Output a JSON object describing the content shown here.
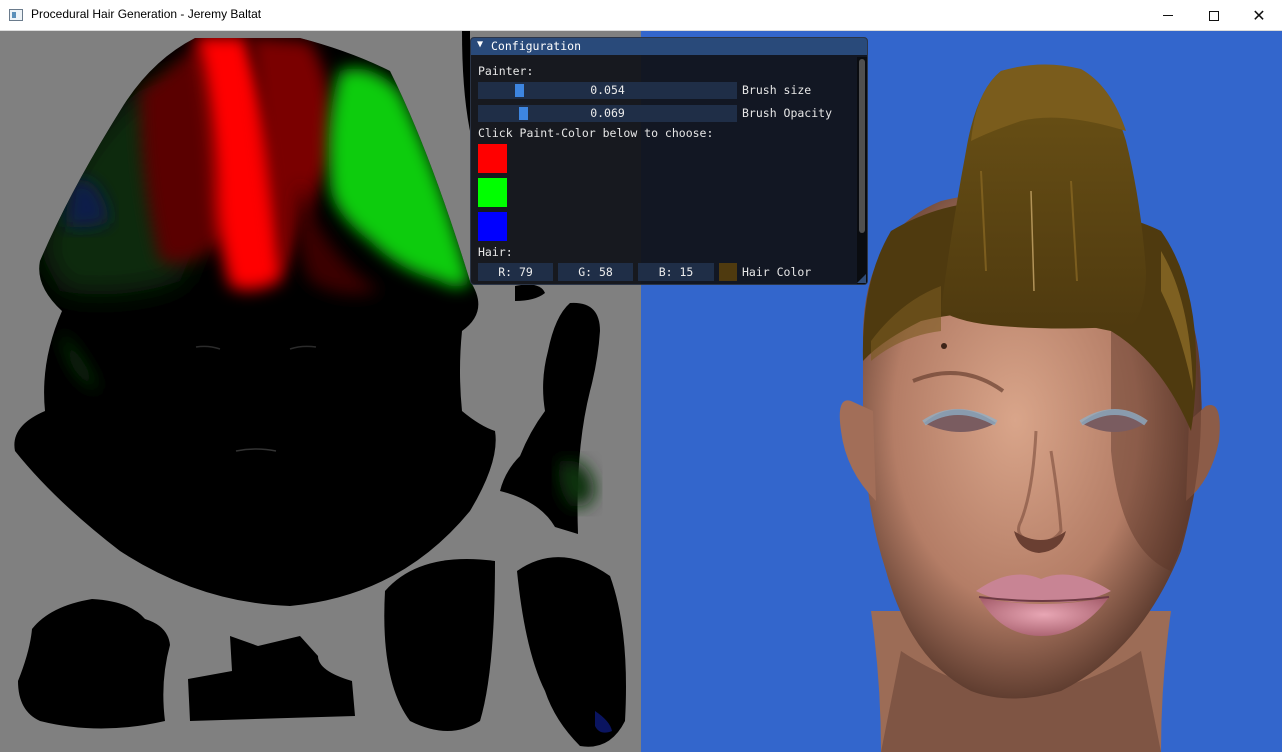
{
  "window": {
    "title": "Procedural Hair Generation - Jeremy Baltat",
    "minimize_icon": "minimize-icon",
    "maximize_icon": "maximize-icon",
    "close_icon": "close-icon",
    "close_glyph": "✕"
  },
  "panel": {
    "collapse_glyph": "▼",
    "title": "Configuration",
    "painter_label": "Painter:",
    "brush_size": {
      "value": "0.054",
      "label": "Brush size",
      "fraction": 0.054
    },
    "brush_opacity": {
      "value": "0.069",
      "label": "Brush Opacity",
      "fraction": 0.069
    },
    "choose_label": "Click Paint-Color below to choose:",
    "paint_colors": [
      "#ff0000",
      "#00ff00",
      "#0000ff"
    ],
    "hair_label": "Hair:",
    "hair_r": "R: 79",
    "hair_g": "G: 58",
    "hair_b": "B: 15",
    "hair_color_hex": "#4f3a0f",
    "hair_color_label": "Hair Color"
  },
  "colors": {
    "uv_background": "#808080",
    "render_background": "#3366cc",
    "panel_title_bar": "#294a7a",
    "slider_grab": "#3d85e0"
  }
}
